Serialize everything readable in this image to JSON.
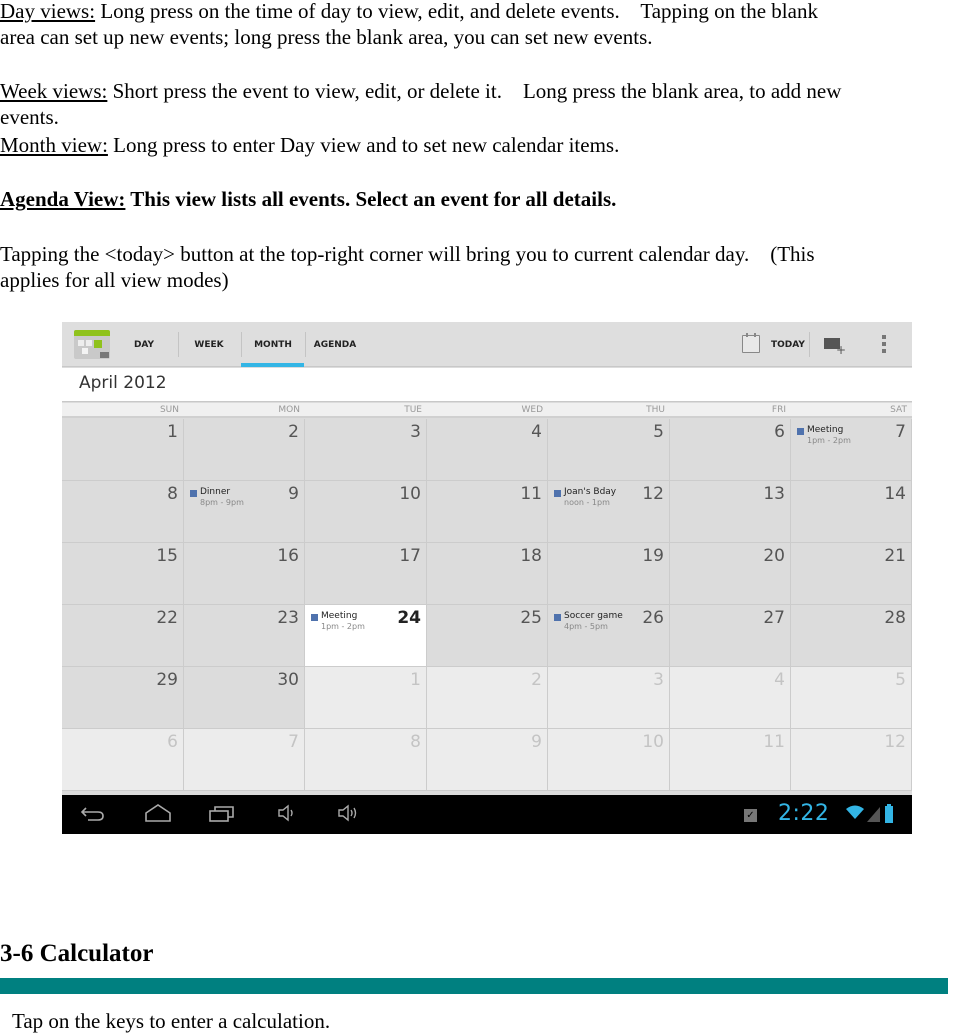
{
  "paragraphs": {
    "day_views": {
      "label": "Day views:",
      "line1": " Long press on the time of day to view, edit, and delete events.    Tapping on the blank",
      "line2": "area can set up new events; long press the blank area, you can set new events."
    },
    "week_views": {
      "label": "Week views:",
      "line1": " Short press the event to view, edit, or delete it.    Long press the blank area, to add new",
      "line2": "events."
    },
    "month_view": {
      "label": "Month view:",
      "text": " Long press to enter Day view and to set new calendar items."
    },
    "agenda_view": {
      "label": "Agenda View:",
      "text": " This view lists all events. Select an event for all details."
    },
    "today_note": {
      "line1": "Tapping the <today> button at the top-right corner will bring you to current calendar day.    (This",
      "line2": "applies for all view modes)"
    }
  },
  "calendar_app": {
    "tabs": [
      {
        "label": "DAY",
        "active": false
      },
      {
        "label": "WEEK",
        "active": false
      },
      {
        "label": "MONTH",
        "active": true
      },
      {
        "label": "AGENDA",
        "active": false
      }
    ],
    "today_label": "TODAY",
    "month_title": "April 2012",
    "weekdays": [
      "SUN",
      "MON",
      "TUE",
      "WED",
      "THU",
      "FRI",
      "SAT"
    ],
    "accent_color": "#33b5e5",
    "event_color": "#4f72ad",
    "weeks": [
      [
        {
          "d": "1",
          "m": "cur"
        },
        {
          "d": "2",
          "m": "cur"
        },
        {
          "d": "3",
          "m": "cur"
        },
        {
          "d": "4",
          "m": "cur"
        },
        {
          "d": "5",
          "m": "cur"
        },
        {
          "d": "6",
          "m": "cur"
        },
        {
          "d": "7",
          "m": "cur",
          "event": {
            "title": "Meeting",
            "time": "1pm - 2pm"
          }
        }
      ],
      [
        {
          "d": "8",
          "m": "cur"
        },
        {
          "d": "9",
          "m": "cur",
          "event": {
            "title": "Dinner",
            "time": "8pm - 9pm"
          }
        },
        {
          "d": "10",
          "m": "cur"
        },
        {
          "d": "11",
          "m": "cur"
        },
        {
          "d": "12",
          "m": "cur",
          "event": {
            "title": "Joan's Bday",
            "time": "noon - 1pm"
          }
        },
        {
          "d": "13",
          "m": "cur"
        },
        {
          "d": "14",
          "m": "cur"
        }
      ],
      [
        {
          "d": "15",
          "m": "cur"
        },
        {
          "d": "16",
          "m": "cur"
        },
        {
          "d": "17",
          "m": "cur"
        },
        {
          "d": "18",
          "m": "cur"
        },
        {
          "d": "19",
          "m": "cur"
        },
        {
          "d": "20",
          "m": "cur"
        },
        {
          "d": "21",
          "m": "cur"
        }
      ],
      [
        {
          "d": "22",
          "m": "cur"
        },
        {
          "d": "23",
          "m": "cur"
        },
        {
          "d": "24",
          "m": "today",
          "event": {
            "title": "Meeting",
            "time": "1pm - 2pm"
          }
        },
        {
          "d": "25",
          "m": "cur"
        },
        {
          "d": "26",
          "m": "cur",
          "event": {
            "title": "Soccer game",
            "time": "4pm - 5pm"
          }
        },
        {
          "d": "27",
          "m": "cur"
        },
        {
          "d": "28",
          "m": "cur"
        }
      ],
      [
        {
          "d": "29",
          "m": "cur"
        },
        {
          "d": "30",
          "m": "cur"
        },
        {
          "d": "1",
          "m": "other"
        },
        {
          "d": "2",
          "m": "other"
        },
        {
          "d": "3",
          "m": "other"
        },
        {
          "d": "4",
          "m": "other"
        },
        {
          "d": "5",
          "m": "other"
        }
      ],
      [
        {
          "d": "6",
          "m": "other"
        },
        {
          "d": "7",
          "m": "other"
        },
        {
          "d": "8",
          "m": "other"
        },
        {
          "d": "9",
          "m": "other"
        },
        {
          "d": "10",
          "m": "other"
        },
        {
          "d": "11",
          "m": "other"
        },
        {
          "d": "12",
          "m": "other"
        }
      ]
    ],
    "status_bar": {
      "time": "2:22",
      "icons": [
        "back-icon",
        "home-icon",
        "recent-apps-icon",
        "volume-down-icon",
        "volume-up-icon",
        "store-icon",
        "wifi-icon",
        "signal-icon",
        "battery-icon"
      ]
    }
  },
  "section": {
    "title": "3-6 Calculator",
    "bar_color": "#008080",
    "body": "Tap on the keys to enter a calculation."
  }
}
